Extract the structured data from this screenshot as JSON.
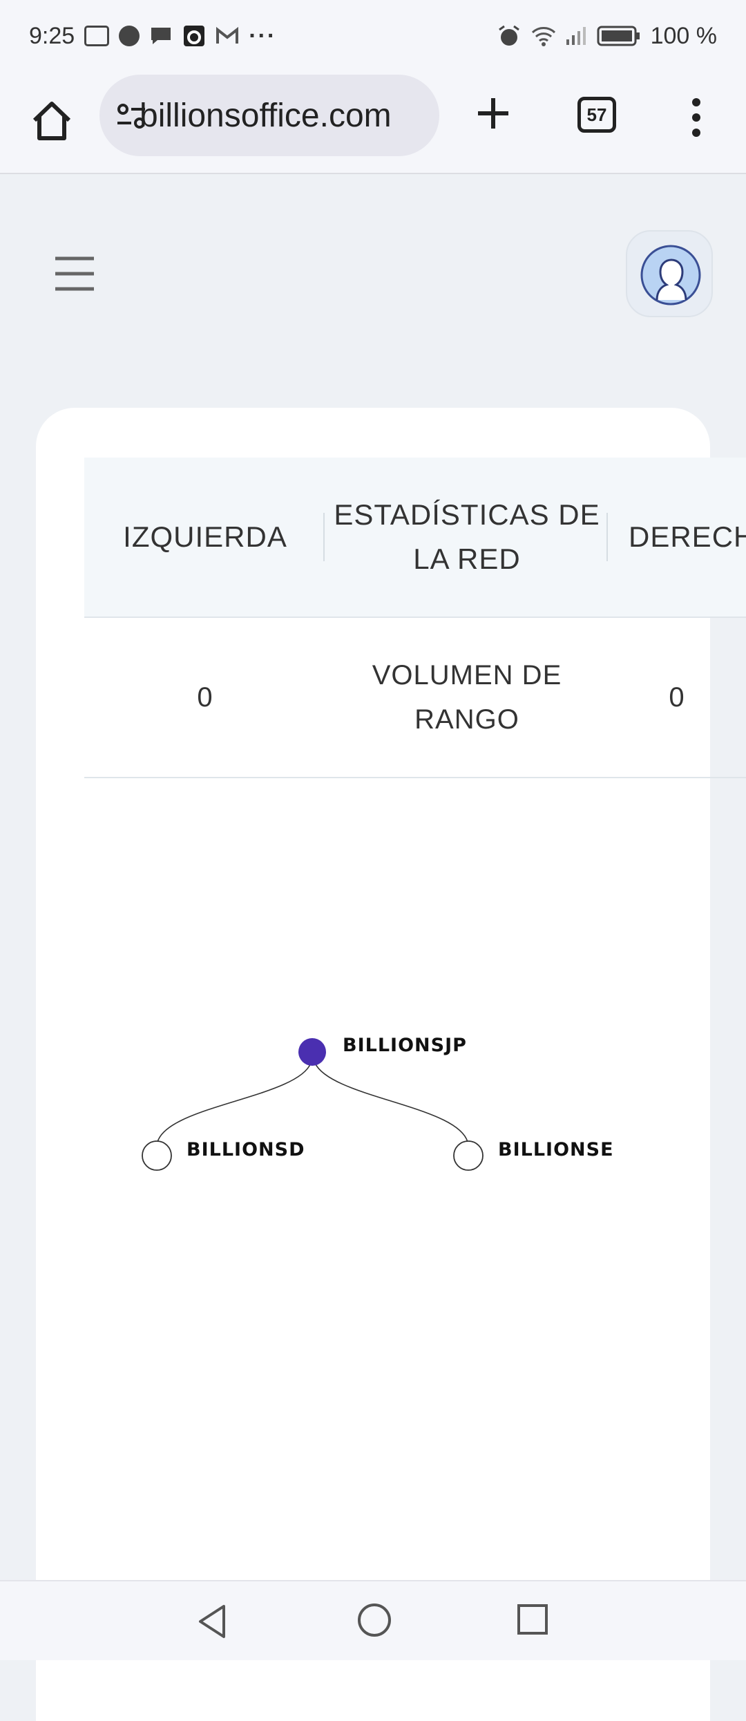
{
  "status_bar": {
    "time": "9:25",
    "battery": "100 %"
  },
  "browser": {
    "url": "billionsoffice.com",
    "tab_count": "57"
  },
  "table": {
    "headers": [
      "IZQUIERDA",
      "ESTADÍSTICAS DE LA RED",
      "DERECHA"
    ],
    "rows": [
      {
        "left": "0",
        "label": "VOLUMEN DE RANGO",
        "right": "0"
      }
    ]
  },
  "tree": {
    "root": {
      "name": "BILLIONSJP",
      "color": "#4a2fb0"
    },
    "children": [
      {
        "name": "BILLIONSD"
      },
      {
        "name": "BILLIONSE"
      }
    ]
  },
  "colors": {
    "page_bg": "#eef1f5",
    "card_bg": "#ffffff",
    "header_bg": "#f3f7fa",
    "accent": "#4a2fb0"
  }
}
